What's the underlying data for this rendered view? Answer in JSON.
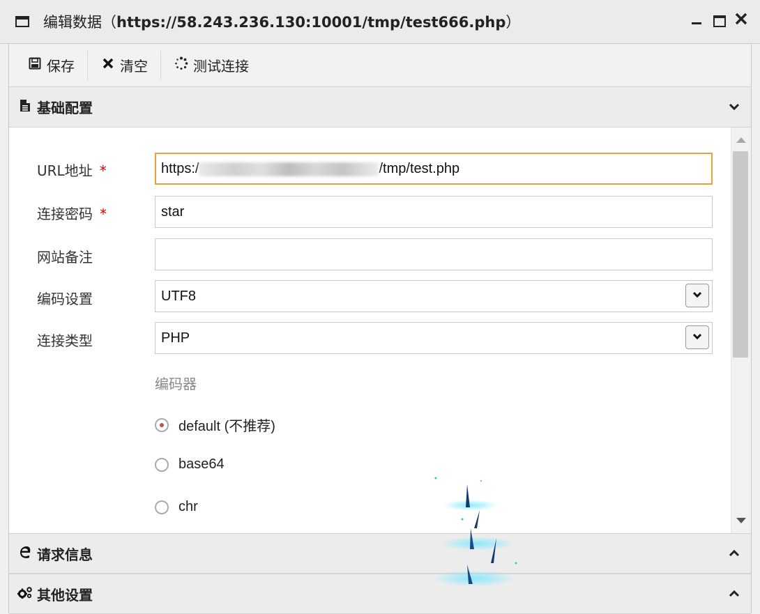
{
  "window": {
    "title_prefix": "编辑数据（",
    "title_url": "https://58.243.236.130:10001/tmp/test666.php",
    "title_suffix": "）",
    "controls": {
      "minimize": "_",
      "maximize": "□",
      "close": "✕"
    }
  },
  "toolbar": {
    "save_label": "保存",
    "clear_label": "清空",
    "test_label": "测试连接",
    "save_icon": "floppy-icon",
    "clear_icon": "x-icon",
    "test_icon": "spinner-icon"
  },
  "sections": {
    "basic": {
      "title": "基础配置",
      "chevron": "⌄"
    },
    "request": {
      "title": "请求信息",
      "chevron": "⌃"
    },
    "other": {
      "title": "其他设置",
      "chevron": "⌃"
    }
  },
  "form": {
    "url": {
      "label": "URL地址",
      "required_mark": "*",
      "value_prefix": "https:/",
      "value_suffix": "/tmp/test.php"
    },
    "password": {
      "label": "连接密码",
      "required_mark": "*",
      "value": "star"
    },
    "note": {
      "label": "网站备注",
      "value": ""
    },
    "encoding": {
      "label": "编码设置",
      "value": "UTF8"
    },
    "type": {
      "label": "连接类型",
      "value": "PHP"
    },
    "encoder": {
      "label": "编码器",
      "options": [
        "default (不推荐)",
        "base64",
        "chr"
      ],
      "selected": "default (不推荐)"
    }
  },
  "colors": {
    "focus_border": "#e6a23c",
    "required": "#dd0000"
  }
}
